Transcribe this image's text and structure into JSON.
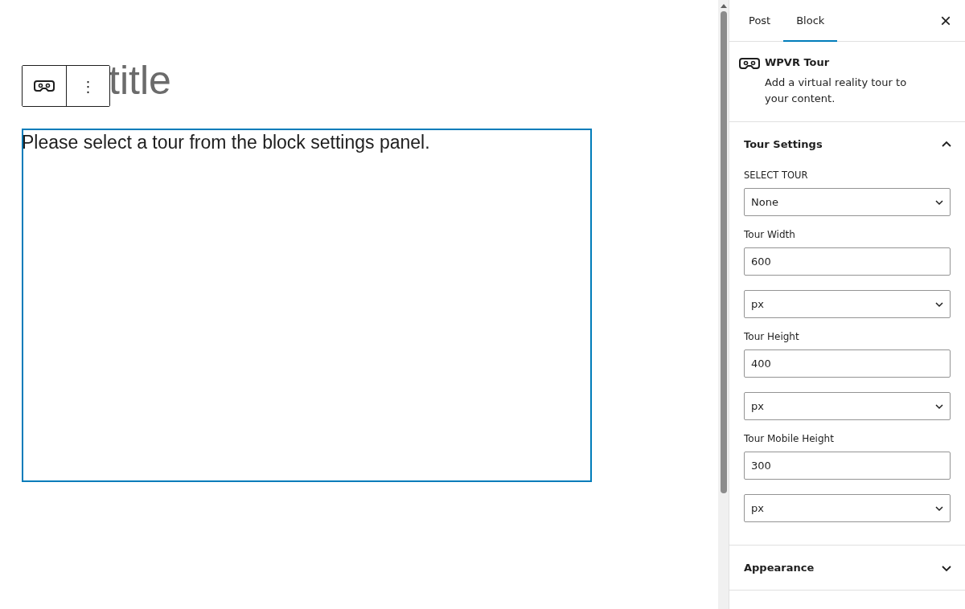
{
  "editor": {
    "title_visible": "title",
    "block_toolbar": {
      "more_label": "⋮"
    },
    "block": {
      "message": "Please select a tour from the block settings panel.",
      "selected": true
    }
  },
  "sidebar": {
    "tabs": [
      {
        "label": "Post",
        "selected": false
      },
      {
        "label": "Block",
        "selected": true
      }
    ],
    "close_label": "×",
    "block_card": {
      "title": "WPVR Tour",
      "description": "Add a virtual reality tour to your content."
    },
    "panels": [
      {
        "title": "Tour Settings",
        "expanded": true,
        "fields": [
          {
            "kind": "select",
            "label": "SELECT TOUR",
            "value": "None"
          },
          {
            "kind": "text",
            "label": "Tour Width",
            "value": "600"
          },
          {
            "kind": "select",
            "value": "px"
          },
          {
            "kind": "text",
            "label": "Tour Height",
            "value": "400"
          },
          {
            "kind": "select",
            "value": "px"
          },
          {
            "kind": "text",
            "label": "Tour Mobile Height",
            "value": "300"
          },
          {
            "kind": "select",
            "value": "px"
          }
        ]
      },
      {
        "title": "Appearance",
        "expanded": false
      }
    ]
  }
}
